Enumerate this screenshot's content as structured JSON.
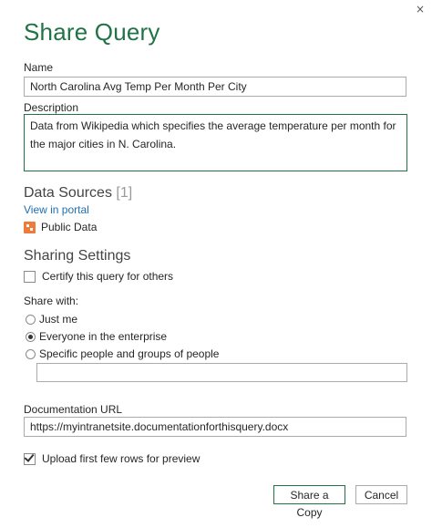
{
  "dialog": {
    "title": "Share Query",
    "close_glyph": "×"
  },
  "name": {
    "label": "Name",
    "value": "North Carolina Avg Temp Per Month Per City"
  },
  "description": {
    "label": "Description",
    "value": "Data from Wikipedia which specifies the average temperature per month for the major cities in N. Carolina."
  },
  "data_sources": {
    "title": "Data Sources",
    "count": "[1]",
    "view_link": "View in portal",
    "items": [
      "Public Data"
    ]
  },
  "sharing": {
    "title": "Sharing Settings",
    "certify_label": "Certify this query for others",
    "certify_checked": false,
    "share_with_label": "Share with:",
    "options": [
      "Just me",
      "Everyone in the enterprise",
      "Specific people and groups of people"
    ],
    "selected_option": "Everyone in the enterprise",
    "people_value": ""
  },
  "documentation": {
    "label": "Documentation URL",
    "value": "https://myintranetsite.documentationforthisquery.docx"
  },
  "upload": {
    "label": "Upload first few rows for preview",
    "checked": true
  },
  "buttons": {
    "share": "Share a Copy",
    "cancel": "Cancel"
  },
  "colors": {
    "accent": "#217346",
    "link": "#1f6fb2",
    "source_icon": "#ee7b3a"
  }
}
